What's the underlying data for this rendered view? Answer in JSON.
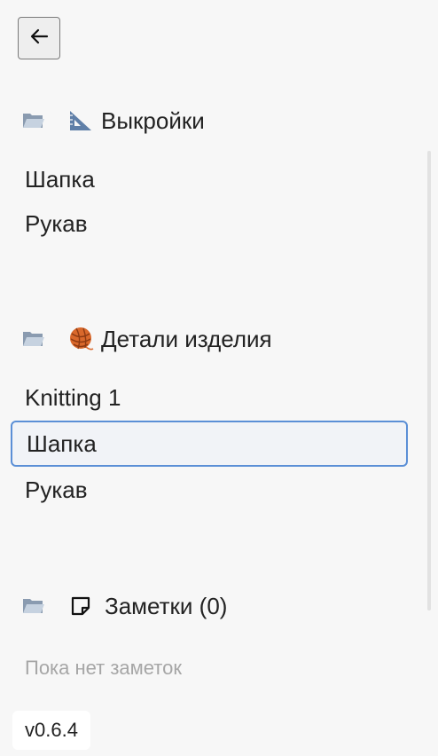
{
  "nav": {
    "back_icon": "arrow-left-icon"
  },
  "sections": {
    "patterns": {
      "folder_icon": "folder-open-icon",
      "header_icon": "triangular-ruler-icon",
      "title": "Выкройки",
      "items": [
        "Шапка",
        "Рукав"
      ]
    },
    "parts": {
      "folder_icon": "folder-open-icon",
      "header_icon": "yarn-ball-icon",
      "title": "Детали изделия",
      "items": [
        "Knitting 1",
        "Шапка",
        "Рукав"
      ],
      "selected_index": 1
    },
    "notes": {
      "folder_icon": "folder-open-icon",
      "header_icon": "note-icon",
      "title": "Заметки (0)",
      "empty_text": "Пока нет заметок"
    }
  },
  "footer": {
    "version": "v0.6.4"
  },
  "colors": {
    "background": "#f7f7f7",
    "selected_border": "#5b8fd6",
    "selected_bg": "#f1f3f7",
    "muted_text": "#a6a6a6",
    "yarn": "#d9682b"
  }
}
